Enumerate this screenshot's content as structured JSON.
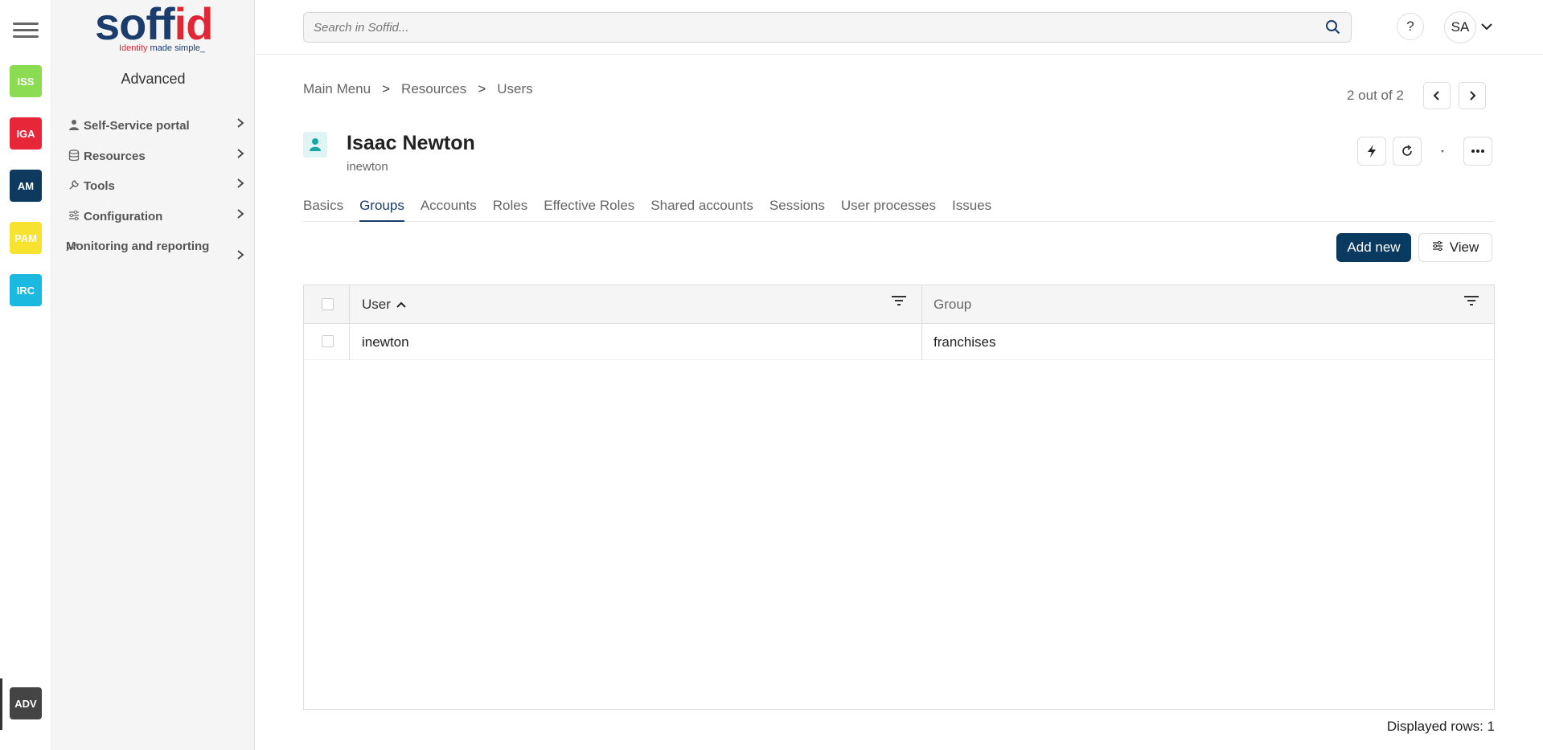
{
  "rail": {
    "items": [
      {
        "label": "ISS",
        "color": "#8bdc52"
      },
      {
        "label": "IGA",
        "color": "#e8263a"
      },
      {
        "label": "AM",
        "color": "#0d3a5e"
      },
      {
        "label": "PAM",
        "color": "#f7e22f"
      },
      {
        "label": "IRC",
        "color": "#1bb8e0"
      },
      {
        "label": "ADV",
        "color": "#444444"
      }
    ]
  },
  "brand": {
    "logo_main": "soff",
    "logo_accent": "id",
    "tag_red": "Identity",
    "tag_blue": " made simple_"
  },
  "nav": {
    "title": "Advanced",
    "items": [
      {
        "label": "Self-Service portal",
        "icon": "person-icon"
      },
      {
        "label": "Resources",
        "icon": "database-icon"
      },
      {
        "label": "Tools",
        "icon": "wrench-icon"
      },
      {
        "label": "Configuration",
        "icon": "sliders-icon"
      },
      {
        "label": "Monitoring and reporting",
        "icon": "chart-line-icon"
      }
    ]
  },
  "header": {
    "search_placeholder": "Search in Soffid...",
    "help_label": "?",
    "avatar_initials": "SA"
  },
  "breadcrumb": {
    "items": [
      "Main Menu",
      "Resources",
      "Users"
    ],
    "separator": ">"
  },
  "pager": {
    "text": "2 out of 2"
  },
  "user": {
    "name": "Isaac Newton",
    "login": "inewton"
  },
  "tabs": {
    "items": [
      "Basics",
      "Groups",
      "Accounts",
      "Roles",
      "Effective Roles",
      "Shared accounts",
      "Sessions",
      "User processes",
      "Issues"
    ],
    "active": "Groups"
  },
  "toolbar": {
    "add_label": "Add new",
    "view_label": "View"
  },
  "table": {
    "columns": [
      "User",
      "Group"
    ],
    "rows": [
      {
        "user": "inewton",
        "group": "franchises"
      }
    ]
  },
  "footer": {
    "rows_text": "Displayed rows: 1"
  },
  "colors": {
    "accent": "#0a3a5f",
    "logo_blue": "#1a3d6d",
    "logo_red": "#e32636"
  }
}
